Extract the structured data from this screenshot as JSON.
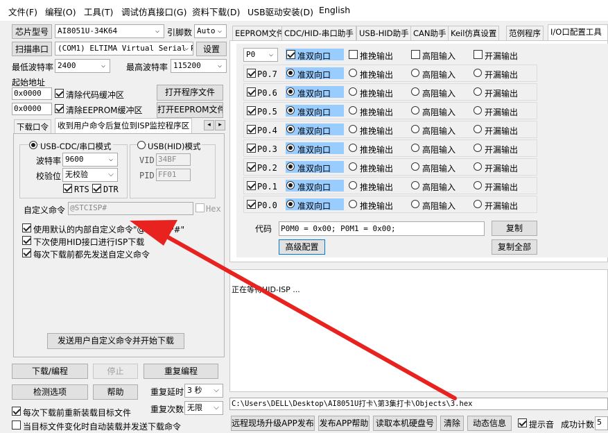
{
  "menu": [
    "文件(F)",
    "编程(O)",
    "工具(T)",
    "调试仿真接口(G)",
    "资料下载(D)",
    "USB驱动安装(D)",
    "English"
  ],
  "left": {
    "chip_button": "芯片型号",
    "chip_value": "AI8051U-34K64",
    "pins_label": "引脚数",
    "pins_value": "Auto",
    "scan_button": "扫描串口",
    "port_value": "(COM1) ELTIMA Virtual Serial P",
    "settings_button": "设置",
    "min_baud_label": "最低波特率",
    "min_baud_value": "2400",
    "max_baud_label": "最高波特率",
    "max_baud_value": "115200",
    "start_addr_label": "起始地址",
    "addr1": "0x0000",
    "clear_code_label": "清除代码缓冲区",
    "open_prog_button": "打开程序文件",
    "addr2": "0x0000",
    "clear_eeprom_label": "清除EEPROM缓冲区",
    "open_eeprom_button": "打开EEPROM文件",
    "tabs": [
      "下载口令",
      "收到用户命令后复位到ISP监控程序区"
    ],
    "usb_cdc_label": "USB-CDC/串口模式",
    "usb_hid_label": "USB(HID)模式",
    "baud_label": "波特率",
    "baud_value": "9600",
    "parity_label": "校验位",
    "parity_value": "无校验",
    "rts_label": "RTS",
    "dtr_label": "DTR",
    "vid_label": "VID",
    "vid_value": "34BF",
    "pid_label": "PID",
    "pid_value": "FF01",
    "custom_cmd_label": "自定义命令",
    "custom_cmd_value": "@STCISP#",
    "hex_label": "Hex",
    "opt1": "使用默认的内部自定义命令\"@STCISP#\"",
    "opt2": "下次使用HID接口进行ISP下载",
    "opt3": "每次下载前都先发送自定义命令",
    "send_button": "发送用户自定义命令并开始下载",
    "download_button": "下载/编程",
    "stop_button": "停止",
    "reprogram_button": "重复编程",
    "check_button": "检测选项",
    "help_button": "帮助",
    "delay_label": "重复延时",
    "delay_value": "3 秒",
    "count_label": "重复次数",
    "count_value": "无限",
    "reload_label": "每次下载前重新装载目标文件",
    "auto_label": "当目标文件变化时自动装载并发送下载命令"
  },
  "right": {
    "tabs": [
      "EEPROM文件",
      "CDC/HID-串口助手",
      "USB-HID助手",
      "CAN助手",
      "Keil仿真设置",
      "范例程序",
      "I/O口配置工具"
    ],
    "port_select": "P0",
    "modes": [
      "准双向口",
      "推挽输出",
      "高阻输入",
      "开漏输出"
    ],
    "pins": [
      "P0.7",
      "P0.6",
      "P0.5",
      "P0.4",
      "P0.3",
      "P0.2",
      "P0.1",
      "P0.0"
    ],
    "code_label": "代码",
    "code_value": "P0M0 = 0x00; P0M1 = 0x00;",
    "copy_button": "复制",
    "advanced_button": "高级配置",
    "copy_all_button": "复制全部",
    "log_text": "正在等待HID-ISP ...",
    "path": "C:\\Users\\DELL\\Desktop\\AI8051U打卡\\第3集打卡\\Objects\\3.hex",
    "bottom_buttons": [
      "远程现场升级APP发布",
      "发布APP帮助",
      "读取本机硬盘号",
      "清除",
      "动态信息"
    ],
    "beep_label": "提示音",
    "success_label": "成功计数",
    "success_value": "5"
  },
  "colors": {
    "highlight": "#99ccff",
    "arrow": "#e8231f"
  }
}
